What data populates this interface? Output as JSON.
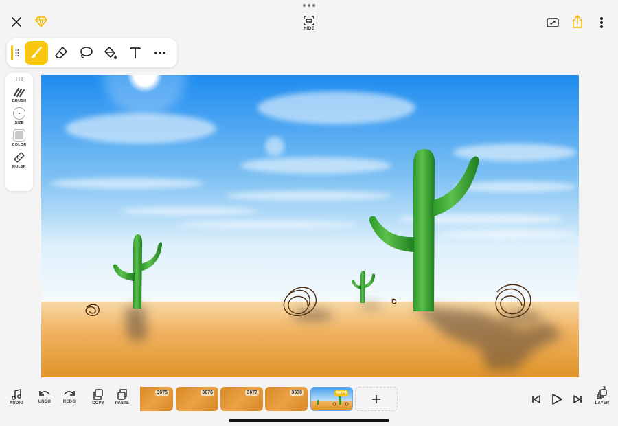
{
  "top": {
    "hide_label": "HIDE",
    "icons": {
      "close": "close-icon",
      "premium": "gem-icon",
      "fit": "fit-screen-icon",
      "share": "share-icon",
      "more": "more-vertical-icon"
    },
    "accent": "#f9c80e"
  },
  "tools": [
    {
      "name": "brush-tool",
      "icon": "paintbrush-icon",
      "active": true
    },
    {
      "name": "eraser-tool",
      "icon": "eraser-icon",
      "active": false
    },
    {
      "name": "lasso-tool",
      "icon": "lasso-icon",
      "active": false
    },
    {
      "name": "fill-tool",
      "icon": "paint-bucket-icon",
      "active": false
    },
    {
      "name": "text-tool",
      "icon": "text-icon",
      "active": false
    },
    {
      "name": "more-tools",
      "icon": "more-horizontal-icon",
      "active": false
    }
  ],
  "side": {
    "brush_label": "BRUSH",
    "size_label": "SIZE",
    "color_label": "COLOR",
    "ruler_label": "RULER",
    "current_color": "#c9c9c9"
  },
  "bottom": {
    "audio_label": "AUDIO",
    "undo_label": "UNDO",
    "redo_label": "REDO",
    "copy_label": "COPY",
    "paste_label": "PASTE",
    "layer_label": "LAYER",
    "layer_count": "3",
    "frames": [
      "3675",
      "3676",
      "3677",
      "3678",
      "3679"
    ],
    "add_frame_icon": "plus-icon",
    "playback_icons": [
      "skip-to-start-icon",
      "play-icon",
      "skip-to-end-icon"
    ]
  }
}
